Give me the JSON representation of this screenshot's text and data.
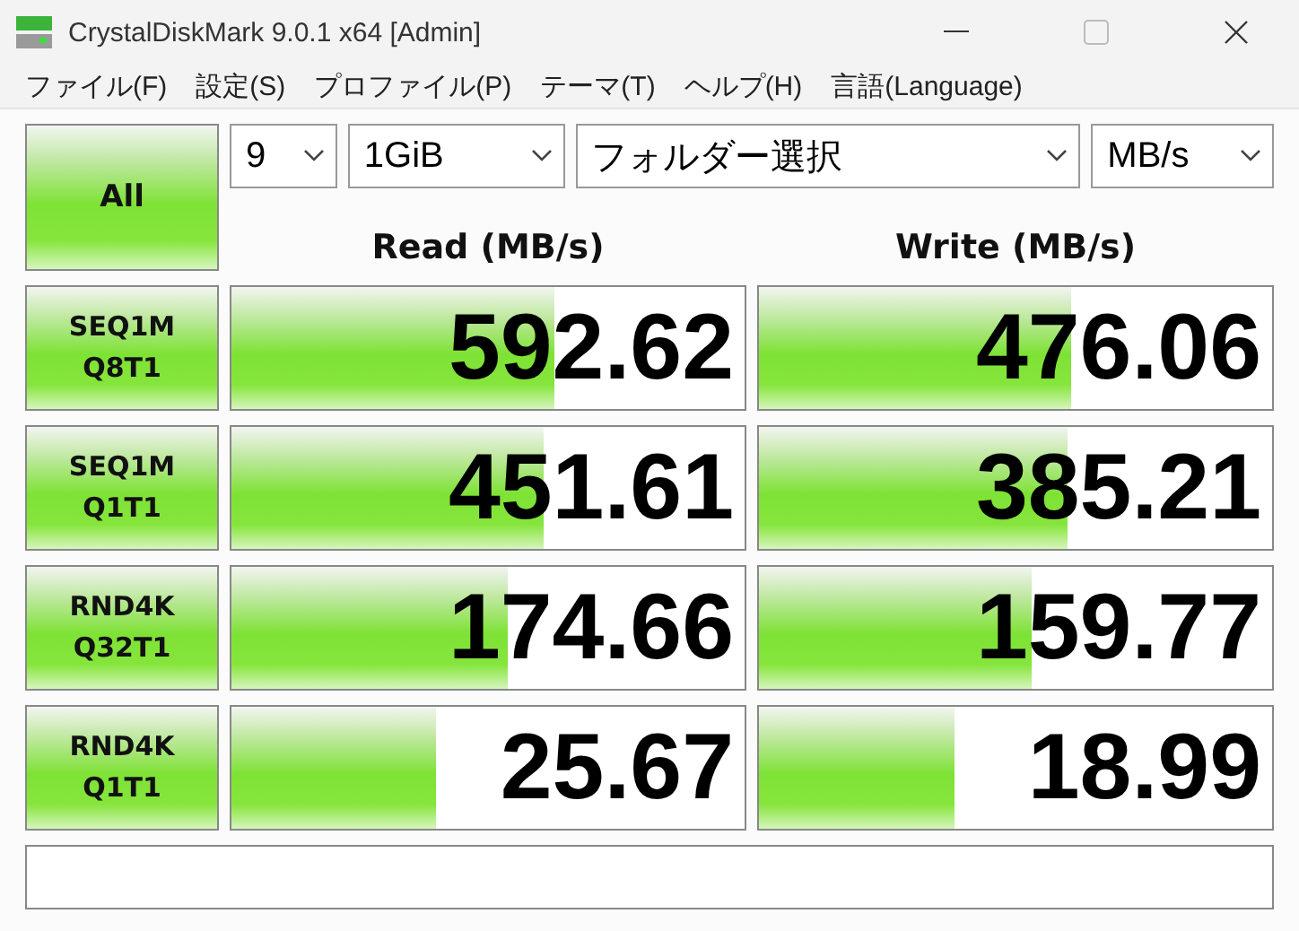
{
  "window": {
    "title": "CrystalDiskMark 9.0.1 x64 [Admin]"
  },
  "menu": [
    "ファイル(F)",
    "設定(S)",
    "プロファイル(P)",
    "テーマ(T)",
    "ヘルプ(H)",
    "言語(Language)"
  ],
  "all_button": "All",
  "selectors": [
    {
      "value": "9"
    },
    {
      "value": "1GiB"
    },
    {
      "value": "フォルダー選択"
    },
    {
      "value": "MB/s"
    }
  ],
  "headers": {
    "read": "Read (MB/s)",
    "write": "Write (MB/s)"
  },
  "tests": [
    {
      "line1": "SEQ1M",
      "line2": "Q8T1",
      "read": {
        "value": "592.62",
        "level": 0.63
      },
      "write": {
        "value": "476.06",
        "level": 0.61
      }
    },
    {
      "line1": "SEQ1M",
      "line2": "Q1T1",
      "read": {
        "value": "451.61",
        "level": 0.61
      },
      "write": {
        "value": "385.21",
        "level": 0.6
      }
    },
    {
      "line1": "RND4K",
      "line2": "Q32T1",
      "read": {
        "value": "174.66",
        "level": 0.54
      },
      "write": {
        "value": "159.77",
        "level": 0.53
      }
    },
    {
      "line1": "RND4K",
      "line2": "Q1T1",
      "read": {
        "value": "25.67",
        "level": 0.4
      },
      "write": {
        "value": "18.99",
        "level": 0.38
      }
    }
  ]
}
